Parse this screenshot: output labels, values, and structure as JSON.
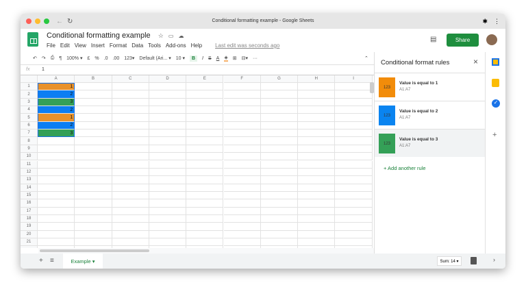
{
  "window": {
    "title": "Conditional formatting example - Google Sheets"
  },
  "header": {
    "doc_title": "Conditional formatting example",
    "menu": [
      "File",
      "Edit",
      "View",
      "Insert",
      "Format",
      "Data",
      "Tools",
      "Add-ons",
      "Help"
    ],
    "last_edit": "Last edit was seconds ago",
    "share": "Share"
  },
  "toolbar": {
    "zoom": "100% ▾",
    "currency": "£",
    "percent": "%",
    "dec_less": ".0",
    "dec_more": ".00",
    "format": "123▾",
    "font": "Default (Ari... ▾",
    "size": "10 ▾",
    "bold": "B",
    "italic": "I",
    "strike": "S",
    "text_color": "A",
    "more": "···"
  },
  "formula": {
    "fx": "fx",
    "value": "1"
  },
  "columns": [
    "A",
    "B",
    "C",
    "D",
    "E",
    "F",
    "G",
    "H",
    "I"
  ],
  "cells": [
    1,
    2,
    3,
    2,
    1,
    2,
    3
  ],
  "colors": {
    "1": "#e8912a",
    "2": "#0c7ef2",
    "3": "#34a057"
  },
  "panel": {
    "title": "Conditional format rules",
    "close": "×",
    "rules": [
      {
        "swatch": "123",
        "text": "Value is equal to 1",
        "range": "A1:A7",
        "color": "#f28c0a"
      },
      {
        "swatch": "123",
        "text": "Value is equal to 2",
        "range": "A1:A7",
        "color": "#0a84f0"
      },
      {
        "swatch": "123",
        "text": "Value is equal to 3",
        "range": "A1:A7",
        "color": "#34a057"
      }
    ],
    "add": "+  Add another rule"
  },
  "bottom": {
    "sheet": "Example ▾",
    "sum": "Sum: 14 ▾",
    "add": "+",
    "list": "≡"
  }
}
